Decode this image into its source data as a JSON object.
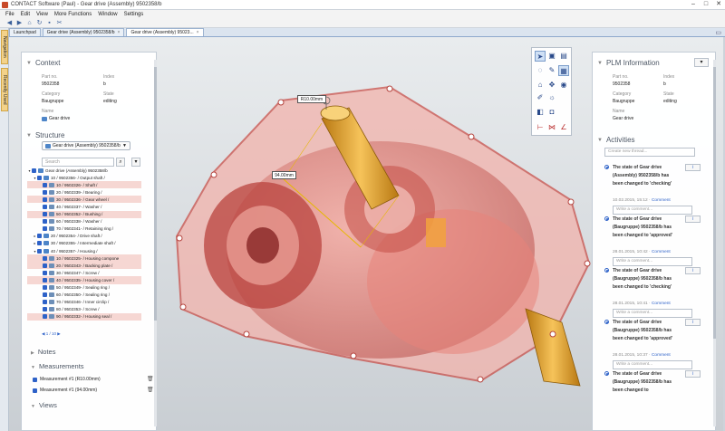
{
  "window": {
    "title": "CONTACT Software (Paul) - Gear drive (Assembly) 9502358/b"
  },
  "menu": [
    "File",
    "Edit",
    "View",
    "More Functions",
    "Window",
    "Settings"
  ],
  "tabs": [
    {
      "label": "Launchpad"
    },
    {
      "label": "Gear drive (Assembly) 9502358/b"
    },
    {
      "label": "Gear drive (Assembly) 95023..."
    }
  ],
  "side_tabs": [
    "Navigation",
    "Recently Used"
  ],
  "context": {
    "title": "Context",
    "fields": [
      {
        "key": "Part no.",
        "value": "9502358"
      },
      {
        "key": "Index",
        "value": "b"
      },
      {
        "key": "Category",
        "value": "Baugruppe"
      },
      {
        "key": "State",
        "value": "editing"
      },
      {
        "key": "Name",
        "value": "Gear drive"
      }
    ]
  },
  "structure": {
    "title": "Structure",
    "selector": "Gear drive (Assembly) 9502358/b",
    "search_placeholder": "Search",
    "rows": [
      {
        "text": "Gear drive (Assembly) 9502358/b",
        "level": 0,
        "tw": "▼",
        "hl": false
      },
      {
        "text": "10 / 9502356- / Output shaft /",
        "level": 1,
        "tw": "▼",
        "hl": false
      },
      {
        "text": "10 / 9502326- / Shaft /",
        "level": 2,
        "tw": "",
        "hl": true
      },
      {
        "text": "20 / 9502339- / Bearing /",
        "level": 2,
        "tw": "",
        "hl": false
      },
      {
        "text": "30 / 9502336- / Gear wheel /",
        "level": 2,
        "tw": "",
        "hl": true
      },
      {
        "text": "40 / 9502337- / Washer /",
        "level": 2,
        "tw": "",
        "hl": false
      },
      {
        "text": "50 / 9502352- / Bushing /",
        "level": 2,
        "tw": "",
        "hl": true
      },
      {
        "text": "60 / 9502338- / Washer /",
        "level": 2,
        "tw": "",
        "hl": false
      },
      {
        "text": "70 / 9502341- / Retaining ring /",
        "level": 2,
        "tw": "",
        "hl": false
      },
      {
        "text": "20 / 9502354- / Drive shaft /",
        "level": 1,
        "tw": "▶",
        "hl": false
      },
      {
        "text": "30 / 9502355- / Intermediate shaft /",
        "level": 1,
        "tw": "▶",
        "hl": false
      },
      {
        "text": "40 / 9502357- / Housing /",
        "level": 1,
        "tw": "▼",
        "hl": false
      },
      {
        "text": "10 / 9502325- / Housing compone",
        "level": 2,
        "tw": "",
        "hl": true
      },
      {
        "text": "20 / 9502343- / Backing plate /",
        "level": 2,
        "tw": "",
        "hl": true
      },
      {
        "text": "30 / 9502347- / Screw /",
        "level": 2,
        "tw": "",
        "hl": false
      },
      {
        "text": "40 / 9502335- / Housing cover /",
        "level": 2,
        "tw": "",
        "hl": true
      },
      {
        "text": "50 / 9502349- / Sealing ring /",
        "level": 2,
        "tw": "",
        "hl": false
      },
      {
        "text": "60 / 9502350- / Sealing ring /",
        "level": 2,
        "tw": "",
        "hl": false
      },
      {
        "text": "70 / 9502346- / Inner circlip /",
        "level": 2,
        "tw": "",
        "hl": false
      },
      {
        "text": "80 / 9502353- / Screw /",
        "level": 2,
        "tw": "",
        "hl": false
      },
      {
        "text": "90 / 9502332- / Housing seal /",
        "level": 2,
        "tw": "",
        "hl": true
      }
    ],
    "pager": "1 / 10"
  },
  "notes": {
    "title": "Notes"
  },
  "measurements": {
    "title": "Measurements",
    "items": [
      {
        "label": "Measurement #1 (R10.00mm)"
      },
      {
        "label": "Measurement #1 (94.00mm)"
      }
    ]
  },
  "views": {
    "title": "Views"
  },
  "viewport": {
    "labels": {
      "radius": "R10.00mm",
      "length": "94.00mm"
    }
  },
  "plm": {
    "title": "PLM Information",
    "fields": [
      {
        "key": "Part no.",
        "value": "9502358"
      },
      {
        "key": "Index",
        "value": "b"
      },
      {
        "key": "Category",
        "value": "Baugruppe"
      },
      {
        "key": "State",
        "value": "editing"
      },
      {
        "key": "Name",
        "value": "Gear drive"
      }
    ]
  },
  "activities": {
    "title": "Activities",
    "new_placeholder": "Create new thread...",
    "comment_placeholder": "Write a comment...",
    "comment_link": "Comment",
    "info_label": "i",
    "items": [
      {
        "message": "The state of Gear drive (Assembly) 9502358/b has been changed to 'checking'",
        "date": "10.02.2015, 15:12"
      },
      {
        "message": "The state of Gear drive (Baugruppe) 9502358/b has been changed to 'approved'",
        "date": "28.01.2015, 10:42"
      },
      {
        "message": "The state of Gear drive (Baugruppe) 9502358/b has been changed to 'checking'",
        "date": "28.01.2015, 10:41"
      },
      {
        "message": "The state of Gear drive (Baugruppe) 9502358/b has been changed to 'approved'",
        "date": "28.01.2015, 10:37"
      },
      {
        "message": "The state of Gear drive (Baugruppe) 9502358/b has been changed to",
        "date": ""
      }
    ]
  }
}
